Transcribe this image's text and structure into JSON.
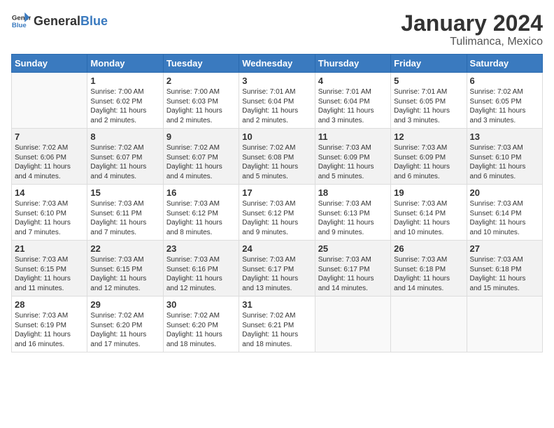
{
  "logo": {
    "general": "General",
    "blue": "Blue"
  },
  "title": "January 2024",
  "location": "Tulimanca, Mexico",
  "weekdays": [
    "Sunday",
    "Monday",
    "Tuesday",
    "Wednesday",
    "Thursday",
    "Friday",
    "Saturday"
  ],
  "weeks": [
    [
      {
        "day": "",
        "info": ""
      },
      {
        "day": "1",
        "info": "Sunrise: 7:00 AM\nSunset: 6:02 PM\nDaylight: 11 hours\nand 2 minutes."
      },
      {
        "day": "2",
        "info": "Sunrise: 7:00 AM\nSunset: 6:03 PM\nDaylight: 11 hours\nand 2 minutes."
      },
      {
        "day": "3",
        "info": "Sunrise: 7:01 AM\nSunset: 6:04 PM\nDaylight: 11 hours\nand 2 minutes."
      },
      {
        "day": "4",
        "info": "Sunrise: 7:01 AM\nSunset: 6:04 PM\nDaylight: 11 hours\nand 3 minutes."
      },
      {
        "day": "5",
        "info": "Sunrise: 7:01 AM\nSunset: 6:05 PM\nDaylight: 11 hours\nand 3 minutes."
      },
      {
        "day": "6",
        "info": "Sunrise: 7:02 AM\nSunset: 6:05 PM\nDaylight: 11 hours\nand 3 minutes."
      }
    ],
    [
      {
        "day": "7",
        "info": "Sunrise: 7:02 AM\nSunset: 6:06 PM\nDaylight: 11 hours\nand 4 minutes."
      },
      {
        "day": "8",
        "info": "Sunrise: 7:02 AM\nSunset: 6:07 PM\nDaylight: 11 hours\nand 4 minutes."
      },
      {
        "day": "9",
        "info": "Sunrise: 7:02 AM\nSunset: 6:07 PM\nDaylight: 11 hours\nand 4 minutes."
      },
      {
        "day": "10",
        "info": "Sunrise: 7:02 AM\nSunset: 6:08 PM\nDaylight: 11 hours\nand 5 minutes."
      },
      {
        "day": "11",
        "info": "Sunrise: 7:03 AM\nSunset: 6:09 PM\nDaylight: 11 hours\nand 5 minutes."
      },
      {
        "day": "12",
        "info": "Sunrise: 7:03 AM\nSunset: 6:09 PM\nDaylight: 11 hours\nand 6 minutes."
      },
      {
        "day": "13",
        "info": "Sunrise: 7:03 AM\nSunset: 6:10 PM\nDaylight: 11 hours\nand 6 minutes."
      }
    ],
    [
      {
        "day": "14",
        "info": "Sunrise: 7:03 AM\nSunset: 6:10 PM\nDaylight: 11 hours\nand 7 minutes."
      },
      {
        "day": "15",
        "info": "Sunrise: 7:03 AM\nSunset: 6:11 PM\nDaylight: 11 hours\nand 7 minutes."
      },
      {
        "day": "16",
        "info": "Sunrise: 7:03 AM\nSunset: 6:12 PM\nDaylight: 11 hours\nand 8 minutes."
      },
      {
        "day": "17",
        "info": "Sunrise: 7:03 AM\nSunset: 6:12 PM\nDaylight: 11 hours\nand 9 minutes."
      },
      {
        "day": "18",
        "info": "Sunrise: 7:03 AM\nSunset: 6:13 PM\nDaylight: 11 hours\nand 9 minutes."
      },
      {
        "day": "19",
        "info": "Sunrise: 7:03 AM\nSunset: 6:14 PM\nDaylight: 11 hours\nand 10 minutes."
      },
      {
        "day": "20",
        "info": "Sunrise: 7:03 AM\nSunset: 6:14 PM\nDaylight: 11 hours\nand 10 minutes."
      }
    ],
    [
      {
        "day": "21",
        "info": "Sunrise: 7:03 AM\nSunset: 6:15 PM\nDaylight: 11 hours\nand 11 minutes."
      },
      {
        "day": "22",
        "info": "Sunrise: 7:03 AM\nSunset: 6:15 PM\nDaylight: 11 hours\nand 12 minutes."
      },
      {
        "day": "23",
        "info": "Sunrise: 7:03 AM\nSunset: 6:16 PM\nDaylight: 11 hours\nand 12 minutes."
      },
      {
        "day": "24",
        "info": "Sunrise: 7:03 AM\nSunset: 6:17 PM\nDaylight: 11 hours\nand 13 minutes."
      },
      {
        "day": "25",
        "info": "Sunrise: 7:03 AM\nSunset: 6:17 PM\nDaylight: 11 hours\nand 14 minutes."
      },
      {
        "day": "26",
        "info": "Sunrise: 7:03 AM\nSunset: 6:18 PM\nDaylight: 11 hours\nand 14 minutes."
      },
      {
        "day": "27",
        "info": "Sunrise: 7:03 AM\nSunset: 6:18 PM\nDaylight: 11 hours\nand 15 minutes."
      }
    ],
    [
      {
        "day": "28",
        "info": "Sunrise: 7:03 AM\nSunset: 6:19 PM\nDaylight: 11 hours\nand 16 minutes."
      },
      {
        "day": "29",
        "info": "Sunrise: 7:02 AM\nSunset: 6:20 PM\nDaylight: 11 hours\nand 17 minutes."
      },
      {
        "day": "30",
        "info": "Sunrise: 7:02 AM\nSunset: 6:20 PM\nDaylight: 11 hours\nand 18 minutes."
      },
      {
        "day": "31",
        "info": "Sunrise: 7:02 AM\nSunset: 6:21 PM\nDaylight: 11 hours\nand 18 minutes."
      },
      {
        "day": "",
        "info": ""
      },
      {
        "day": "",
        "info": ""
      },
      {
        "day": "",
        "info": ""
      }
    ]
  ]
}
